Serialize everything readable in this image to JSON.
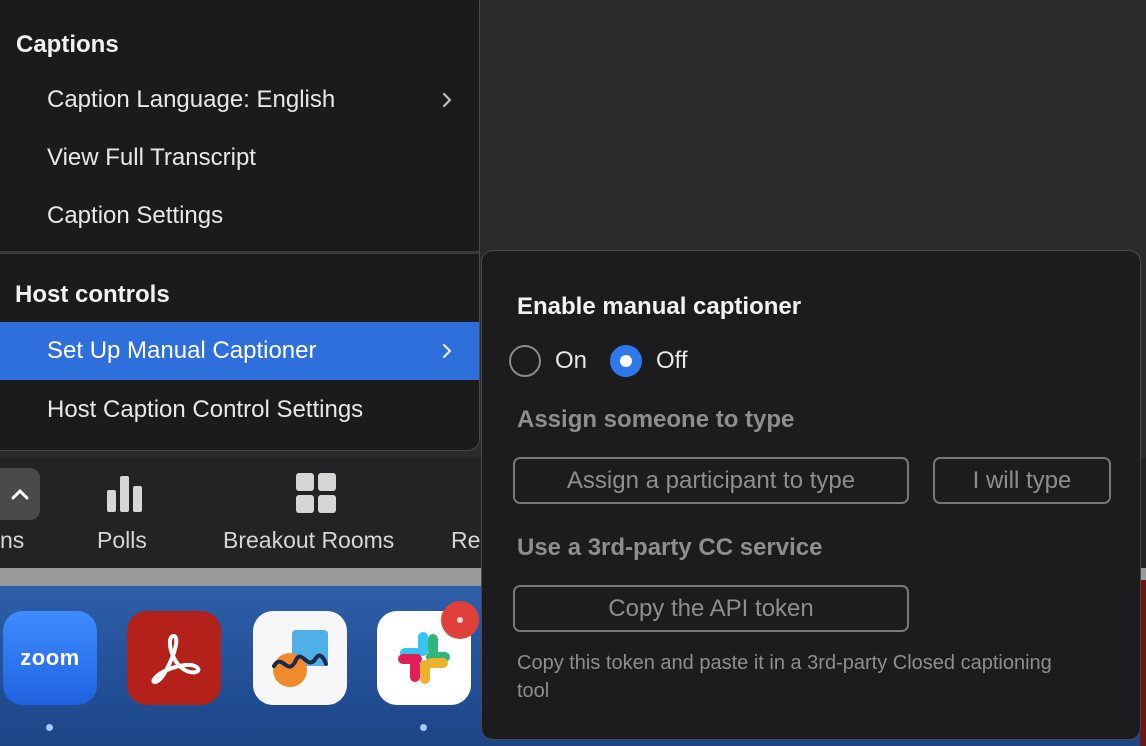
{
  "captions_menu": {
    "header": "Captions",
    "items": [
      {
        "label": "Caption Language: English",
        "has_submenu": true
      },
      {
        "label": "View Full Transcript"
      },
      {
        "label": "Caption Settings"
      }
    ]
  },
  "host_controls_menu": {
    "header": "Host controls",
    "items": [
      {
        "label": "Set Up Manual Captioner",
        "has_submenu": true,
        "selected": true
      },
      {
        "label": "Host Caption Control Settings"
      }
    ]
  },
  "manual_captioner_panel": {
    "title": "Enable manual captioner",
    "on_label": "On",
    "off_label": "Off",
    "selected": "Off",
    "assign_section": "Assign someone to type",
    "assign_participant_button": "Assign a participant to type",
    "i_will_type_button": "I will type",
    "third_party_section": "Use a 3rd-party CC service",
    "copy_token_button": "Copy the API token",
    "description": "Copy this token and paste it in a 3rd-party Closed captioning tool"
  },
  "toolbar": {
    "partial_left_label": "ns",
    "polls_label": "Polls",
    "breakout_label": "Breakout Rooms",
    "partial_right_label": "Re"
  },
  "dock": {
    "zoom_label": "zoom",
    "apps": [
      "zoom",
      "acrobat",
      "freeform",
      "slack"
    ]
  },
  "colors": {
    "accent": "#2f6fdc",
    "radio_selected": "#2f78ea",
    "menu_bg": "#1b1b1d"
  }
}
